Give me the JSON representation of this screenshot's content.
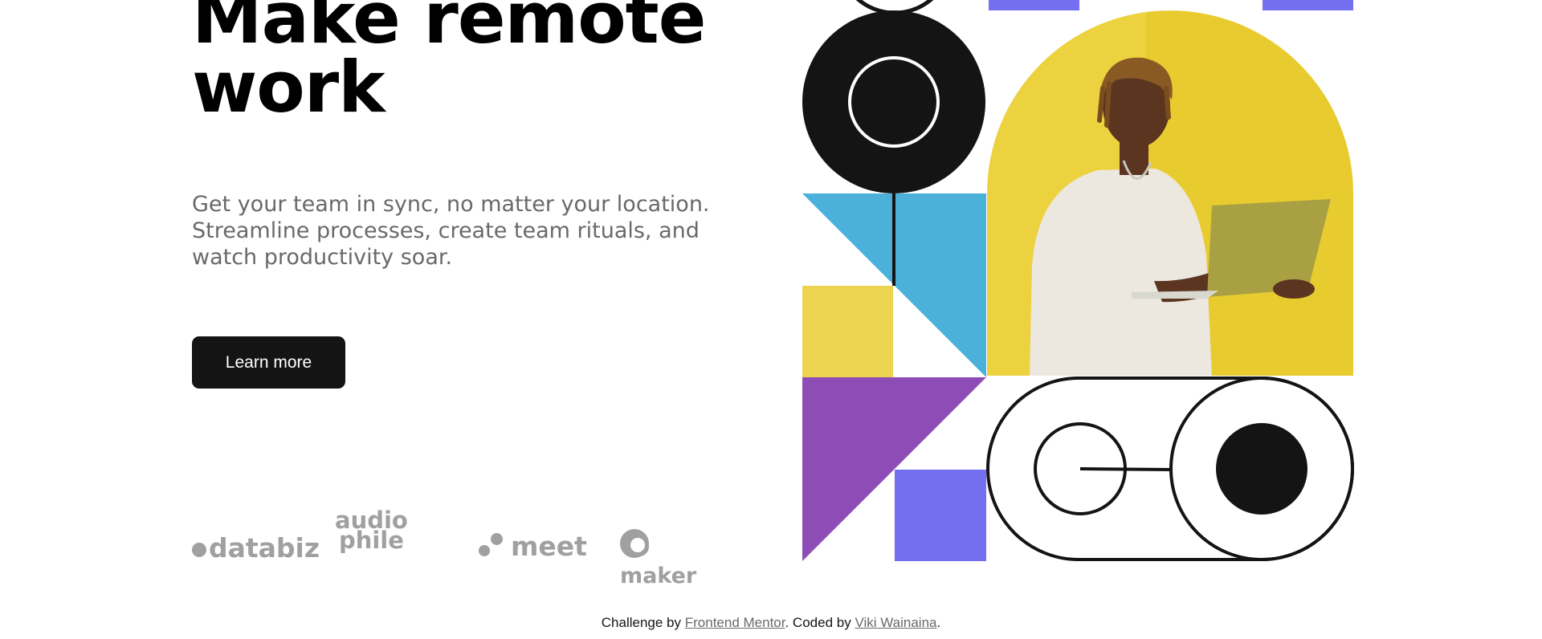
{
  "hero": {
    "title_lines": [
      "Make remote",
      "work"
    ],
    "description_lines": [
      "Get your team in sync, no matter your location.",
      "Streamline processes, create team rituals, and",
      "watch productivity soar."
    ],
    "cta_label": "Learn more"
  },
  "clients": {
    "databiz": "databiz",
    "audiophile_lines": [
      "audio",
      "phile"
    ],
    "meet": "meet",
    "maker": "maker"
  },
  "illustration": {
    "icon": "remote-work-illustration",
    "colors": {
      "black": "#141414",
      "blue": "#4bb1da",
      "yellow": "#ecd450",
      "purple": "#8e4cb6",
      "violet": "#746ef0",
      "photo_background": "#e8cc2f"
    }
  },
  "footer": {
    "prefix": "Challenge by ",
    "link1": "Frontend Mentor",
    "middle": ". Coded by ",
    "link2": "Viki Wainaina",
    "suffix": "."
  },
  "theme": {
    "text_gray": "#696969",
    "button_bg": "#141414",
    "logo_gray": "#a0a0a0"
  }
}
